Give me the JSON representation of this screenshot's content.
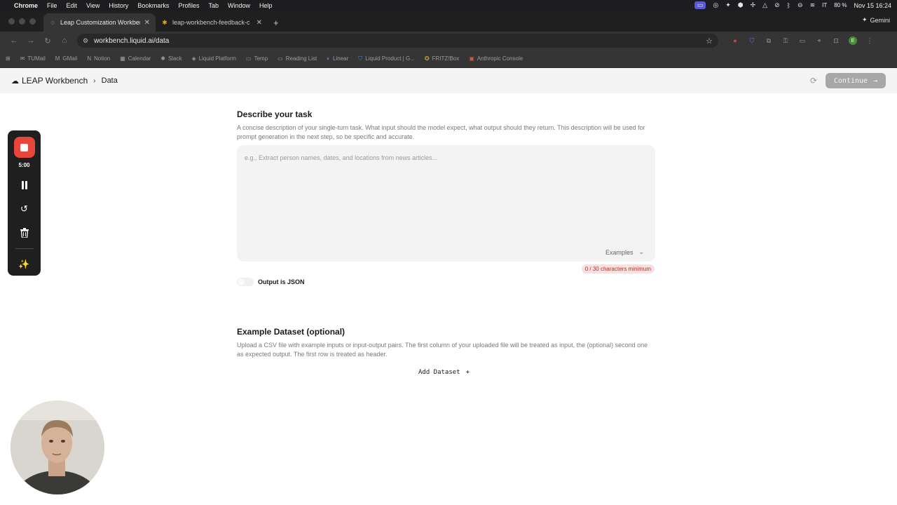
{
  "menubar": {
    "app_name": "Chrome",
    "items": [
      "File",
      "Edit",
      "View",
      "History",
      "Bookmarks",
      "Profiles",
      "Tab",
      "Window",
      "Help"
    ],
    "keyboard": "IT",
    "battery": "80 %",
    "datetime": "Nov 15  16:24"
  },
  "tabs": [
    {
      "title": "Leap Customization Workbench"
    },
    {
      "title": "leap-workbench-feedback-c"
    }
  ],
  "gemini_label": "Gemini",
  "url": "workbench.liquid.ai/data",
  "bookmarks": [
    "TUMail",
    "GMail",
    "Notion",
    "Calendar",
    "Slack",
    "Liquid Platform",
    "Temp",
    "Reading List",
    "Linear",
    "Liquid Product | G...",
    "FRITZ!Box",
    "Anthropic Console"
  ],
  "app": {
    "brand": "LEAP Workbench",
    "breadcrumb": "Data",
    "continue_label": "Continue"
  },
  "task": {
    "title": "Describe your task",
    "description": "A concise description of your single-turn task. What input should the model expect, what output should they return. This description will be used for prompt generation in the next step, so be specific and accurate.",
    "placeholder": "e.g., Extract person names, dates, and locations from news articles...",
    "examples_label": "Examples",
    "char_count": "0 / 30 characters minimum",
    "json_label": "Output is JSON"
  },
  "dataset": {
    "title": "Example Dataset (optional)",
    "description": "Upload a CSV file with example inputs or input-output pairs. The first column of your uploaded file will be treated as input, the (optional) second one as expected output. The first row is treated as header.",
    "add_label": "Add Dataset"
  },
  "recorder": {
    "time": "5:00"
  },
  "colors": {
    "record_red": "#e8463b",
    "continue_disabled": "#a7a7a7",
    "warning_bg": "#fbe0e0"
  }
}
